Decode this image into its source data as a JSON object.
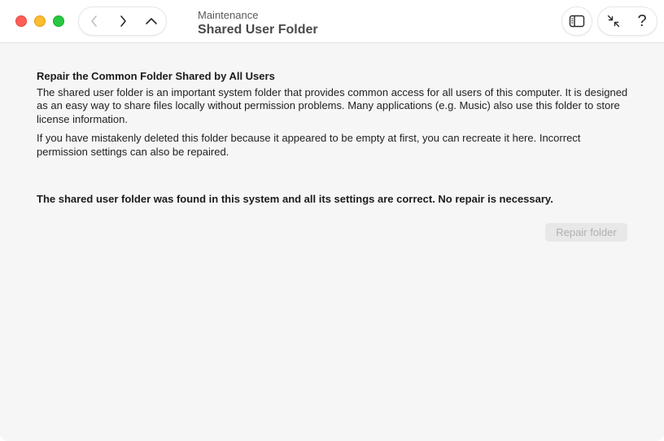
{
  "window": {
    "title_sub": "Maintenance",
    "title_main": "Shared User Folder"
  },
  "toolbar": {
    "back_icon": "chevron-left-icon",
    "forward_icon": "chevron-right-icon",
    "up_icon": "chevron-up-icon",
    "sidebar_icon": "sidebar-icon",
    "collapse_icon": "collapse-arrows-icon",
    "help_label": "?"
  },
  "main": {
    "heading": "Repair the Common Folder Shared by All Users",
    "paragraph_1": "The shared user folder is an important system folder that provides common access for all users of this computer. It is designed as an easy way to share files locally without permission problems. Many applications (e.g. Music) also use this folder to store license information.",
    "paragraph_2": "If you have mistakenly deleted this folder because it appeared to be empty at first, you can recreate it here. Incorrect permission settings can also be repaired.",
    "status": "The shared user folder was found in this system and all its settings are correct. No repair is necessary.",
    "repair_button_label": "Repair folder"
  },
  "colors": {
    "close": "#ff5f57",
    "minimize": "#febc2e",
    "zoom": "#28c840",
    "background": "#f6f6f6"
  }
}
